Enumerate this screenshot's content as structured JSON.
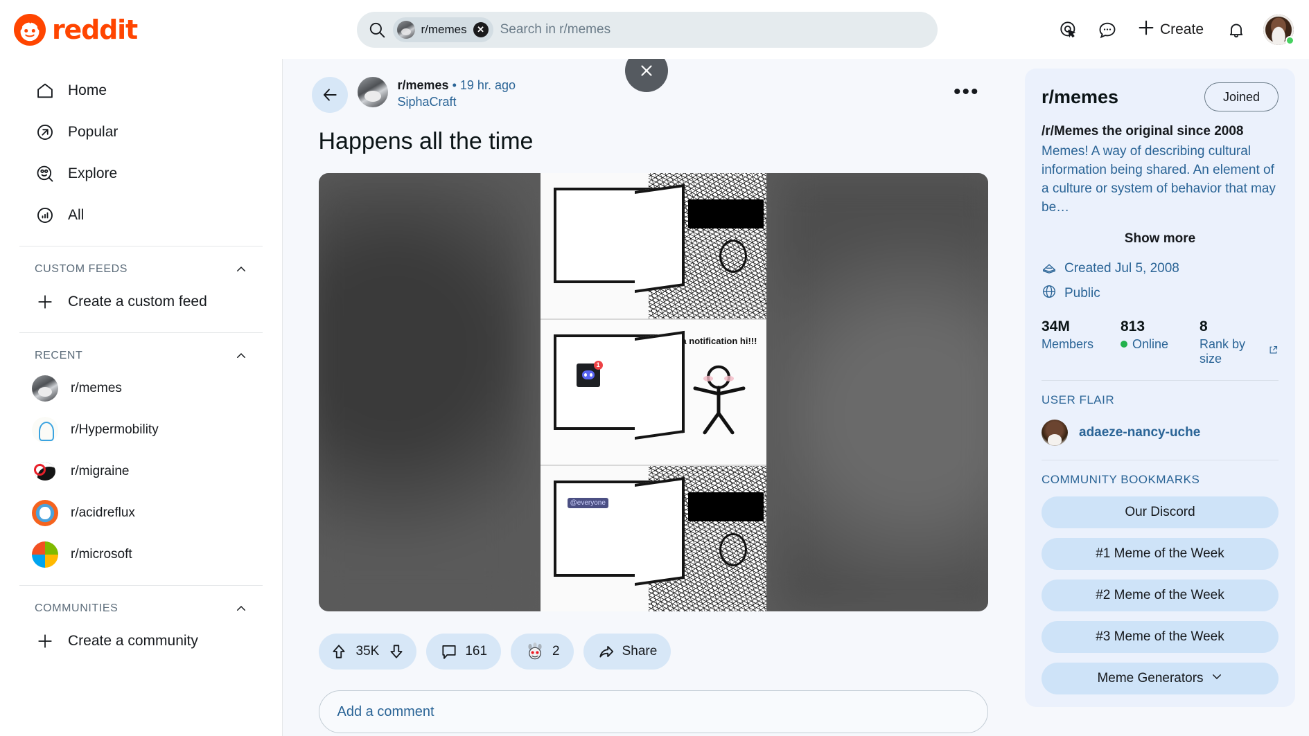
{
  "header": {
    "logo_text": "reddit",
    "search": {
      "chip_label": "r/memes",
      "placeholder": "Search in r/memes",
      "value": ""
    },
    "create_label": "Create",
    "icons": [
      "advertise-icon",
      "chat-icon",
      "plus-icon",
      "notification-bell-icon",
      "user-avatar"
    ]
  },
  "sidebar": {
    "nav": [
      {
        "label": "Home",
        "icon": "home-icon"
      },
      {
        "label": "Popular",
        "icon": "popular-arrow-icon"
      },
      {
        "label": "Explore",
        "icon": "explore-icon"
      },
      {
        "label": "All",
        "icon": "all-bars-icon"
      }
    ],
    "custom_feeds": {
      "title": "CUSTOM FEEDS",
      "create_label": "Create a custom feed"
    },
    "recent": {
      "title": "RECENT",
      "items": [
        {
          "label": "r/memes",
          "avatar": "cat-avatar"
        },
        {
          "label": "r/Hypermobility",
          "avatar": "hand-avatar"
        },
        {
          "label": "r/migraine",
          "avatar": "migraine-avatar"
        },
        {
          "label": "r/acidreflux",
          "avatar": "snoo-flame-avatar"
        },
        {
          "label": "r/microsoft",
          "avatar": "microsoft-logo-avatar"
        }
      ]
    },
    "communities": {
      "title": "COMMUNITIES",
      "create_label": "Create a community"
    }
  },
  "post": {
    "subreddit": "r/memes",
    "separator": "•",
    "time": "19 hr. ago",
    "author": "SiphaCraft",
    "title": "Happens all the time",
    "more_label": "•••",
    "media": {
      "panel2_caption": "omg   a notification hi!!!",
      "panel2_badge": "1",
      "panel3_tag": "@everyone"
    },
    "actions": {
      "upvotes": "35K",
      "comments": "161",
      "awards": "2",
      "share_label": "Share"
    },
    "comment_placeholder": "Add a comment"
  },
  "community": {
    "name": "r/memes",
    "joined_label": "Joined",
    "tagline": "/r/Memes the original since 2008",
    "description": "Memes! A way of describing cultural information being shared. An element of a culture or system of behavior that may be…",
    "show_more": "Show more",
    "created": "Created Jul 5, 2008",
    "visibility": "Public",
    "stats": [
      {
        "value": "34M",
        "label": "Members"
      },
      {
        "value": "813",
        "label": "Online"
      },
      {
        "value": "8",
        "label": "Rank by size"
      }
    ],
    "user_flair": {
      "title": "USER FLAIR",
      "name": "adaeze-nancy-uche"
    },
    "bookmarks": {
      "title": "COMMUNITY BOOKMARKS",
      "items": [
        {
          "label": "Our Discord",
          "has_chevron": false
        },
        {
          "label": "#1 Meme of the Week",
          "has_chevron": false
        },
        {
          "label": "#2 Meme of the Week",
          "has_chevron": false
        },
        {
          "label": "#3 Meme of the Week",
          "has_chevron": false
        },
        {
          "label": "Meme Generators",
          "has_chevron": true
        }
      ]
    }
  },
  "colors": {
    "brand": "#FF4500",
    "link": "#2a6496",
    "pill": "#D7E7F7",
    "card": "#EBF1FC",
    "online": "#22b14c"
  }
}
